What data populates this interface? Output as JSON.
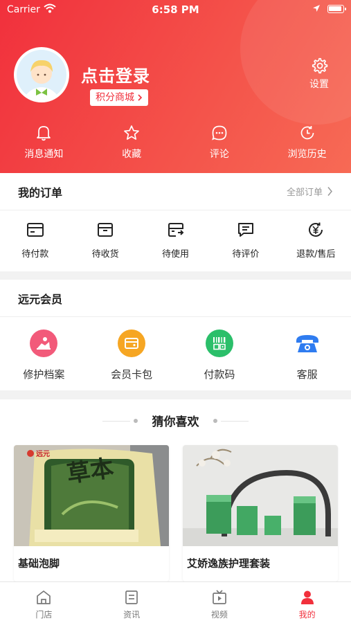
{
  "status_bar": {
    "carrier": "Carrier",
    "time": "6:58 PM"
  },
  "profile": {
    "login_text": "点击登录",
    "points_mall_label": "积分商城",
    "settings_label": "设置"
  },
  "quick_links": [
    {
      "label": "消息通知",
      "icon": "bell-icon"
    },
    {
      "label": "收藏",
      "icon": "star-icon"
    },
    {
      "label": "评论",
      "icon": "comment-icon"
    },
    {
      "label": "浏览历史",
      "icon": "history-icon"
    }
  ],
  "orders": {
    "title": "我的订单",
    "all_label": "全部订单",
    "items": [
      {
        "label": "待付款",
        "icon": "wallet-icon"
      },
      {
        "label": "待收货",
        "icon": "box-icon"
      },
      {
        "label": "待使用",
        "icon": "ticket-icon"
      },
      {
        "label": "待评价",
        "icon": "review-icon"
      },
      {
        "label": "退款/售后",
        "icon": "refund-icon"
      }
    ]
  },
  "membership": {
    "title": "远元会员",
    "items": [
      {
        "label": "修护档案",
        "icon": "profile-record-icon",
        "color": "#f25a7a"
      },
      {
        "label": "会员卡包",
        "icon": "card-wallet-icon",
        "color": "#f6a623"
      },
      {
        "label": "付款码",
        "icon": "payment-code-icon",
        "color": "#2bbf6a"
      },
      {
        "label": "客服",
        "icon": "phone-icon",
        "color": "#2f7cf0"
      }
    ]
  },
  "recommend": {
    "title": "猜你喜欢",
    "products": [
      {
        "name": "基础泡脚",
        "image_text": "草本",
        "image_brand": "远元"
      },
      {
        "name": "艾娇逸族护理套装"
      }
    ]
  },
  "tabbar": {
    "items": [
      {
        "label": "门店",
        "icon": "store-icon"
      },
      {
        "label": "资讯",
        "icon": "news-icon"
      },
      {
        "label": "视频",
        "icon": "video-icon"
      },
      {
        "label": "我的",
        "icon": "user-icon",
        "active": true
      }
    ]
  },
  "colors": {
    "primary": "#f1303c",
    "gradient_end": "#f76a55"
  }
}
